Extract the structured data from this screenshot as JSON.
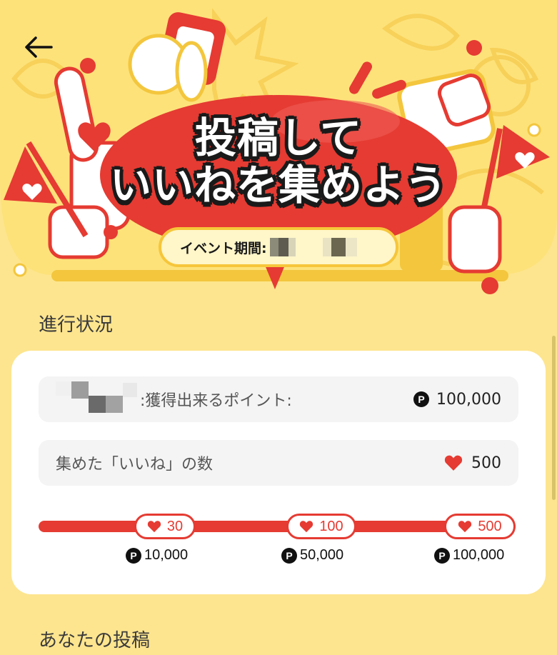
{
  "header": {
    "back_icon": "arrow-left-icon",
    "title_line1": "投稿して",
    "title_line2": "いいねを集めよう",
    "period_label": "イベント期間:",
    "colors": {
      "banner_bg": "#fde27a",
      "accent_red": "#e53b32",
      "pill_border": "#f6c63a"
    }
  },
  "progress": {
    "section_title": "進行状況",
    "points_row": {
      "label": ":獲得出来るポイント:",
      "value": "100,000",
      "icon": "point-coin-icon"
    },
    "likes_row": {
      "label": "集めた「いいね」の数",
      "value": "500",
      "icon": "heart-icon"
    },
    "milestones": [
      {
        "likes": "30",
        "reward": "10,000"
      },
      {
        "likes": "100",
        "reward": "50,000"
      },
      {
        "likes": "500",
        "reward": "100,000"
      }
    ]
  },
  "posts": {
    "section_title": "あなたの投稿"
  }
}
